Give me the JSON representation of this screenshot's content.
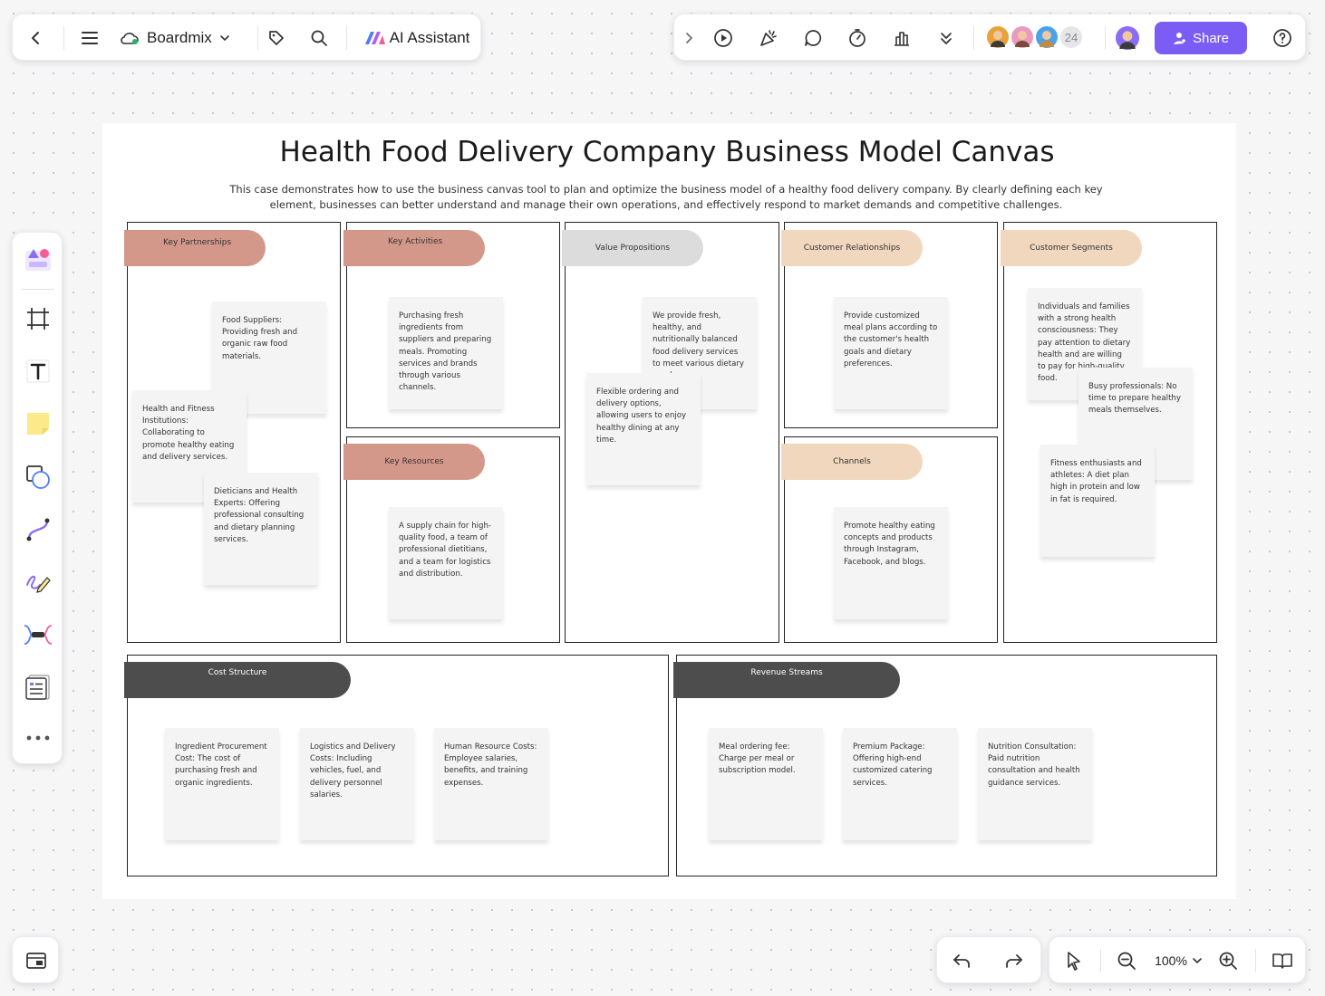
{
  "toolbar_left": {
    "back_label": "Back",
    "brand": "Boardmix",
    "ai_label": "AI Assistant"
  },
  "toolbar_right": {
    "collaborator_count": "24",
    "share_label": "Share"
  },
  "board": {
    "title": "Health Food Delivery Company Business Model Canvas",
    "description": "This case demonstrates how to use the business canvas tool to plan and optimize the business model of a healthy food delivery company. By clearly defining each key element, businesses can better understand and manage their own operations, and effectively respond to market demands and competitive challenges.",
    "sections": {
      "key_partnerships": "Key Partnerships",
      "key_activities": "Key Activities",
      "key_resources": "Key Resources",
      "value_propositions": "Value Propositions",
      "customer_relationships": "Customer Relationships",
      "channels": "Channels",
      "customer_segments": "Customer Segments",
      "cost_structure": "Cost Structure",
      "revenue_streams": "Revenue Streams"
    },
    "notes": {
      "kp1": "Food Suppliers: Providing fresh and organic raw food materials.",
      "kp2": "Health and Fitness Institutions: Collaborating to promote healthy eating and delivery services.",
      "kp3": "Dieticians and Health Experts: Offering professional consulting and dietary planning services.",
      "ka1": "Purchasing fresh ingredients from suppliers and preparing meals. Promoting services and brands through various channels.",
      "kr1": "A supply chain for high-quality food, a team of professional dietitians, and a team for logistics and distribution.",
      "vp1": "We provide fresh, healthy, and nutritionally balanced food delivery services to meet various dietary needs.",
      "vp2": "Flexible ordering and delivery options, allowing users to enjoy healthy dining at any time.",
      "cr1": "Provide customized meal plans according to the customer's health goals and dietary preferences.",
      "ch1": "Promote healthy eating concepts and products through Instagram, Facebook, and blogs.",
      "cs1": "Individuals and families with a strong health consciousness: They pay attention to dietary health and are willing to pay for high-quality food.",
      "cs2": "Busy professionals: No time to prepare healthy meals themselves.",
      "cs3": "Fitness enthusiasts and athletes: A diet plan high in protein and low in fat is required.",
      "cost1": "Ingredient Procurement Cost: The cost of purchasing fresh and organic ingredients.",
      "cost2": "Logistics and Delivery Costs: Including vehicles, fuel, and delivery personnel salaries.",
      "cost3": "Human Resource Costs: Employee salaries, benefits, and training expenses.",
      "rev1": "Meal ordering fee: Charge per meal or subscription model.",
      "rev2": "Premium Package: Offering high-end customized catering services.",
      "rev3": "Nutrition Consultation: Paid nutrition consultation and health guidance services."
    }
  },
  "zoom": {
    "level": "100%"
  },
  "colors": {
    "accent": "#7b5cf5",
    "pill_partner": "#d4988a",
    "pill_value": "#dcdcdc",
    "pill_customer": "#f0d7bd",
    "pill_cost": "#4d4d4d"
  },
  "icons": [
    "back-icon",
    "menu-icon",
    "cloud-icon",
    "chevron-down-icon",
    "tag-icon",
    "search-icon",
    "ai-logo-icon",
    "expand-icon",
    "present-icon",
    "celebrate-icon",
    "comment-icon",
    "timer-icon",
    "vote-icon",
    "more-down-icon",
    "help-icon",
    "template-icon",
    "frame-icon",
    "text-icon",
    "sticky-note-icon",
    "shape-icon",
    "connector-icon",
    "pen-icon",
    "mindmap-icon",
    "table-icon",
    "more-icon",
    "minimap-icon",
    "undo-icon",
    "redo-icon",
    "select-icon",
    "zoom-out-icon",
    "zoom-in-icon",
    "book-icon"
  ]
}
